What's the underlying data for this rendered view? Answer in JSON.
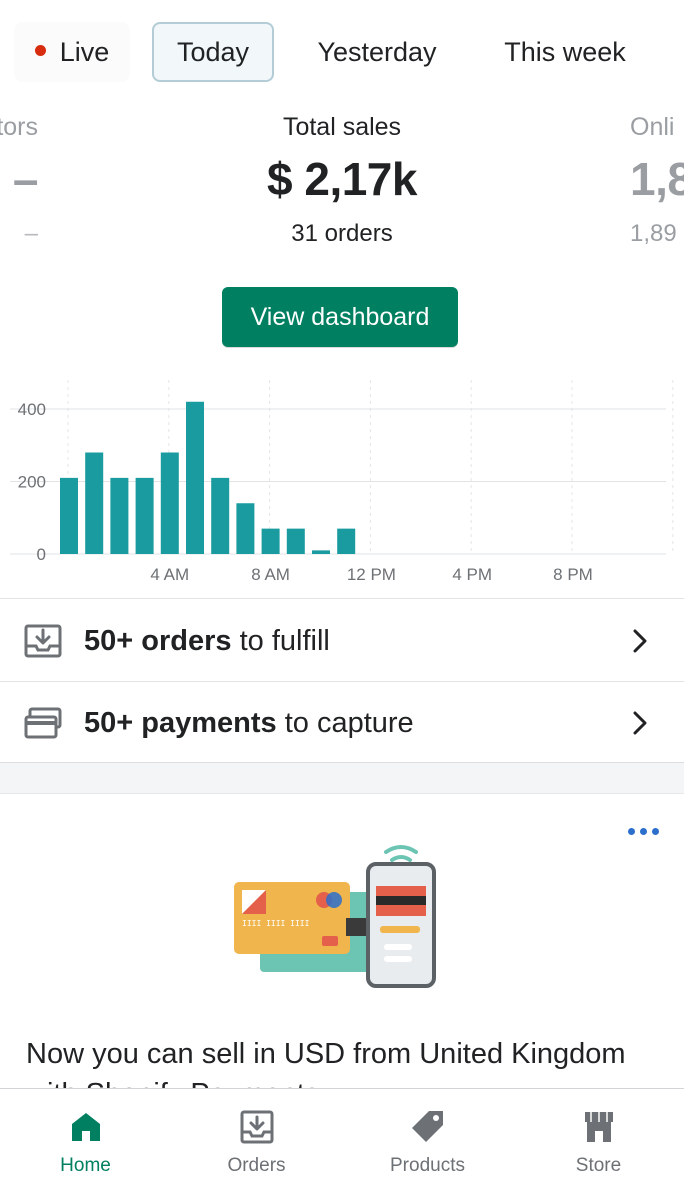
{
  "tabs": {
    "live": "Live",
    "today": "Today",
    "yesterday": "Yesterday",
    "this_week": "This week"
  },
  "metrics": {
    "left": {
      "label": "tors",
      "value": "–",
      "sub": "–"
    },
    "center": {
      "label": "Total sales",
      "value": "$ 2,17k",
      "sub": "31 orders"
    },
    "right": {
      "label": "Onli",
      "value": "1,8",
      "sub": "1,89"
    }
  },
  "view_dashboard": "View dashboard",
  "chart_data": {
    "type": "bar",
    "title": "",
    "xlabel": "",
    "ylabel": "",
    "ylim": [
      0,
      480
    ],
    "y_ticks": [
      "0",
      "200",
      "400"
    ],
    "x_tick_labels": [
      "4 AM",
      "8 AM",
      "12 PM",
      "4 PM",
      "8 PM"
    ],
    "categories": [
      "12 AM",
      "1 AM",
      "2 AM",
      "3 AM",
      "4 AM",
      "5 AM",
      "6 AM",
      "7 AM",
      "8 AM",
      "9 AM",
      "10 AM",
      "11 AM",
      "12 PM",
      "1 PM",
      "2 PM",
      "3 PM",
      "4 PM",
      "5 PM",
      "6 PM",
      "7 PM",
      "8 PM",
      "9 PM",
      "10 PM",
      "11 PM"
    ],
    "values": [
      210,
      280,
      210,
      210,
      280,
      420,
      210,
      140,
      70,
      70,
      10,
      70,
      0,
      0,
      0,
      0,
      0,
      0,
      0,
      0,
      0,
      0,
      0,
      0
    ],
    "bar_color": "#1a9ba0",
    "grid": true
  },
  "actions": [
    {
      "bold": "50+ orders",
      "rest": " to fulfill",
      "icon": "download-tray-icon"
    },
    {
      "bold": "50+ payments",
      "rest": " to capture",
      "icon": "credit-cards-icon"
    }
  ],
  "promo": {
    "title": "Now you can sell in USD from United Kingdom with Shopify Payments",
    "icon": "card-and-phone-illustration"
  },
  "nav": [
    {
      "label": "Home",
      "icon": "home-icon",
      "active": true
    },
    {
      "label": "Orders",
      "icon": "orders-icon",
      "active": false
    },
    {
      "label": "Products",
      "icon": "tag-icon",
      "active": false
    },
    {
      "label": "Store",
      "icon": "store-icon",
      "active": false
    }
  ],
  "colors": {
    "brand_green": "#008060",
    "live_red": "#d72c0d",
    "bar_teal": "#1a9ba0",
    "link_blue": "#2c6ecb"
  }
}
